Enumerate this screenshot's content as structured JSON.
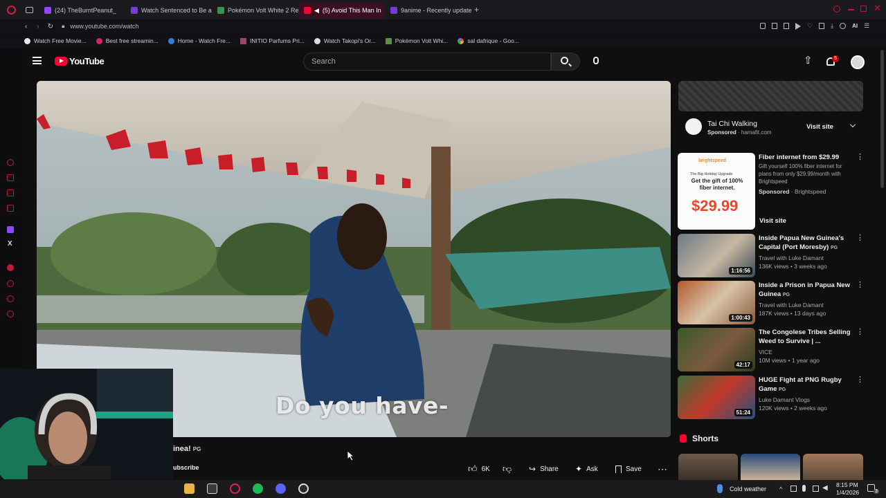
{
  "browser": {
    "tabs": [
      {
        "label": "(24) TheBurntPeanut_",
        "active": false
      },
      {
        "label": "Watch Sentenced to Be a",
        "active": false
      },
      {
        "label": "Pokémon Volt White 2 Re",
        "active": false
      },
      {
        "label": "(5) Avoid This Man In",
        "active": true
      },
      {
        "label": "9anime - Recently update",
        "active": false
      }
    ],
    "url": "www.youtube.com/watch",
    "ai_label": "AI",
    "bookmarks": [
      "Watch Free Movie...",
      "Best free streamin...",
      "Home - Watch Fre...",
      "INITIO Parfums Pri...",
      "Watch Takopi's Or...",
      "Pokémon Volt Whi...",
      "sal dafrique - Goo..."
    ]
  },
  "youtube": {
    "logo_text": "YouTube",
    "search_placeholder": "Search",
    "notification_count": "5"
  },
  "video": {
    "caption": "Do you have-",
    "title_fragment": "inea!",
    "title_badge": "PG",
    "subscribe_fragment": "ubscribe",
    "likes": "6K",
    "share_label": "Share",
    "ask_label": "Ask",
    "save_label": "Save"
  },
  "ad": {
    "title": "Tai Chi Walking",
    "sponsored": "Sponsored",
    "domain": "hamafit.com",
    "visit": "Visit site"
  },
  "sidebar": {
    "sponsored_item": {
      "title": "Fiber internet from $29.99",
      "desc": "Gift yourself 100% fiber internet for plans from only $29.99/month with Brightspeed",
      "sponsored": "Sponsored",
      "advertiser": "Brightspeed",
      "visit": "Visit site",
      "thumb_brand": "brightspeed",
      "thumb_line1": "The Big Holiday Upgrade",
      "thumb_headline": "Get the gift of 100% fiber internet.",
      "thumb_price": "$29.99"
    },
    "items": [
      {
        "title": "Inside Papua New Guinea's Capital (Port Moresby)",
        "badge": "PG",
        "channel": "Travel with Luke Damant",
        "meta": "136K views • 3 weeks ago",
        "duration": "1:16:56"
      },
      {
        "title": "Inside a Prison in Papua New Guinea",
        "badge": "PG",
        "channel": "Travel with Luke Damant",
        "meta": "187K views • 13 days ago",
        "duration": "1:00:43"
      },
      {
        "title": "The Congolese Tribes Selling Weed to Survive | ...",
        "badge": "",
        "channel": "VICE",
        "meta": "10M views • 1 year ago",
        "duration": "42:17"
      },
      {
        "title": "HUGE Fight at PNG Rugby Game",
        "badge": "PG",
        "channel": "Luke Damant Vlogs",
        "meta": "120K views • 2 weeks ago",
        "duration": "51:24"
      }
    ],
    "shorts_label": "Shorts"
  },
  "taskbar": {
    "weather": "Cold weather",
    "time": "8:15 PM",
    "date": "1/4/2026",
    "notif": "3"
  },
  "colors": {
    "accent": "#cc1e3a",
    "yt_red": "#ff0033",
    "bg": "#0f0f0f"
  }
}
